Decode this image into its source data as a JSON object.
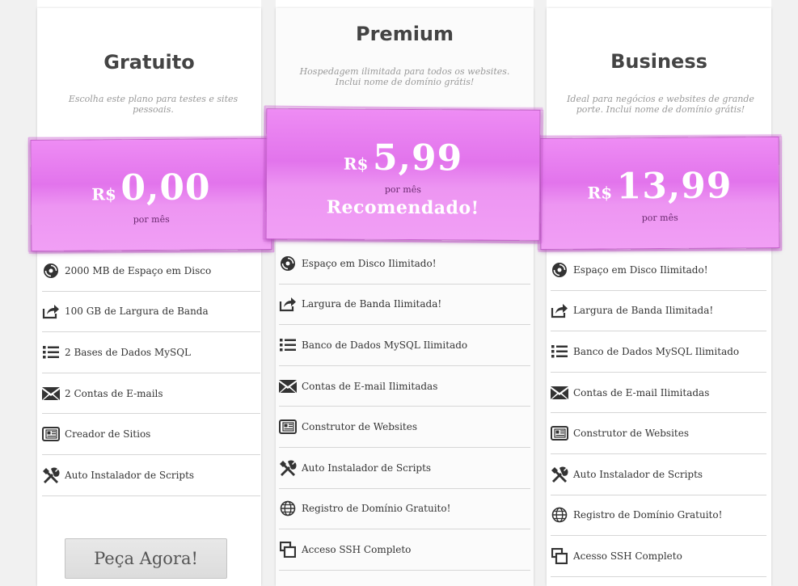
{
  "plans": [
    {
      "title": "Gratuito",
      "description": "Escolha este plano para testes e sites pessoais.",
      "currency": "R$",
      "price": "0,00",
      "period": "por mês",
      "features": [
        {
          "icon": "disk-icon",
          "label": "2000 MB de Espaço em Disco"
        },
        {
          "icon": "share-icon",
          "label": "100 GB de Largura de Banda"
        },
        {
          "icon": "list-icon",
          "label": "2 Bases de Dados MySQL"
        },
        {
          "icon": "envelope-icon",
          "label": "2 Contas de E-mails"
        },
        {
          "icon": "newspaper-icon",
          "label": "Creador de Sitios"
        },
        {
          "icon": "tools-icon",
          "label": "Auto Instalador de Scripts"
        }
      ],
      "order_button": "Peça Agora!"
    },
    {
      "title": "Premium",
      "description": "Hospedagem ilimitada para todos os websites. Inclui nome de domínio grátis!",
      "currency": "R$",
      "price": "5,99",
      "period": "por mês",
      "badge": "Recomendado!",
      "features": [
        {
          "icon": "disk-icon",
          "label": "Espaço em Disco Ilimitado!"
        },
        {
          "icon": "share-icon",
          "label": "Largura de Banda Ilimitada!"
        },
        {
          "icon": "list-icon",
          "label": "Banco de Dados MySQL Ilimitado"
        },
        {
          "icon": "envelope-icon",
          "label": "Contas de E-mail Ilimitadas"
        },
        {
          "icon": "newspaper-icon",
          "label": "Construtor de Websites"
        },
        {
          "icon": "tools-icon",
          "label": "Auto Instalador de Scripts"
        },
        {
          "icon": "globe-icon",
          "label": "Registro de Domínio Gratuito!"
        },
        {
          "icon": "windows-icon",
          "label": "Acceso SSH Completo"
        }
      ]
    },
    {
      "title": "Business",
      "description": "Ideal para negócios e websites de grande porte. Inclui nome de domínio grátis!",
      "currency": "R$",
      "price": "13,99",
      "period": "por mês",
      "features": [
        {
          "icon": "disk-icon",
          "label": "Espaço em Disco Ilimitado!"
        },
        {
          "icon": "share-icon",
          "label": "Largura de Banda Ilimitada!"
        },
        {
          "icon": "list-icon",
          "label": "Banco de Dados MySQL Ilimitado"
        },
        {
          "icon": "envelope-icon",
          "label": "Contas de E-mail Ilimitadas"
        },
        {
          "icon": "newspaper-icon",
          "label": "Construtor de Websites"
        },
        {
          "icon": "tools-icon",
          "label": "Auto Instalador de Scripts"
        },
        {
          "icon": "globe-icon",
          "label": "Registro de Domínio Gratuito!"
        },
        {
          "icon": "windows-icon",
          "label": "Acesso SSH Completo"
        }
      ]
    }
  ],
  "colors": {
    "price_box": "#e77ef0",
    "price_box_border": "#c760cd",
    "column_bg": "#ffffff",
    "page_bg": "#f1f1f1"
  }
}
